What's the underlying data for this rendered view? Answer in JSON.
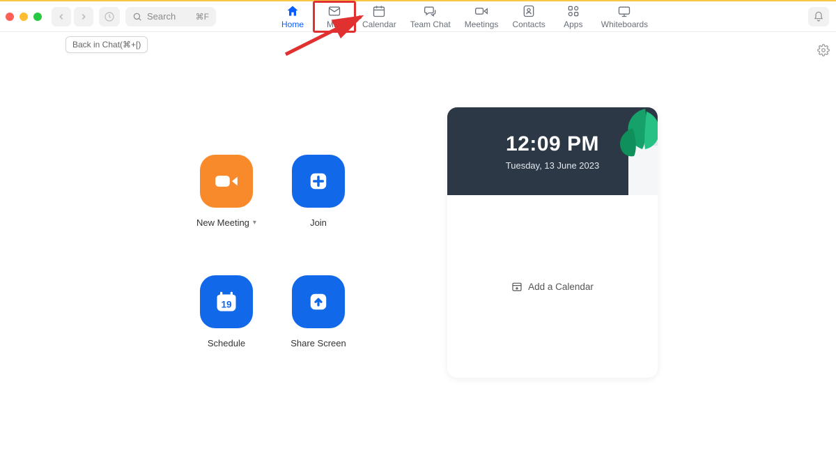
{
  "search": {
    "placeholder": "Search",
    "shortcut": "⌘F"
  },
  "tooltip": "Back in Chat(⌘+[)",
  "tabs": [
    {
      "id": "home",
      "label": "Home",
      "active": true
    },
    {
      "id": "mail",
      "label": "Mail",
      "highlight": true
    },
    {
      "id": "calendar",
      "label": "Calendar"
    },
    {
      "id": "teamchat",
      "label": "Team Chat"
    },
    {
      "id": "meetings",
      "label": "Meetings"
    },
    {
      "id": "contacts",
      "label": "Contacts"
    },
    {
      "id": "apps",
      "label": "Apps"
    },
    {
      "id": "whiteboards",
      "label": "Whiteboards"
    }
  ],
  "actions": {
    "new_meeting": "New Meeting",
    "join": "Join",
    "schedule": "Schedule",
    "share_screen": "Share Screen",
    "schedule_day": "19"
  },
  "widget": {
    "time": "12:09 PM",
    "date": "Tuesday, 13 June 2023",
    "add_calendar": "Add a Calendar"
  }
}
